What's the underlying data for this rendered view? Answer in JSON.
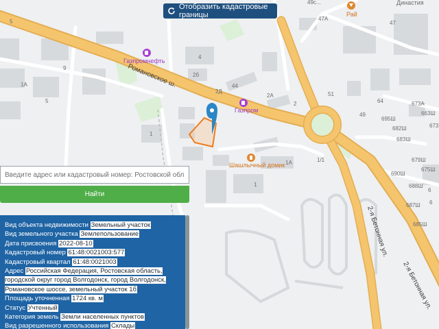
{
  "map": {
    "labels": {
      "street_romanovskoe": "Романовское ш.",
      "street_betonnaya_1": "2-я Бетонная ул.",
      "street_betonnaya_2": "2-я Бетонная ул.",
      "poi_gazpromneft": "Газпромнефть",
      "poi_gazprom": "Газпром",
      "poi_shashlychny": "Шашлычный домик",
      "poi_rai": "Рай",
      "poi_dinastia": "Династия"
    },
    "house_numbers": {
      "n5_top": "5",
      "n9": "9",
      "n1a_left": "1А",
      "n5_left": "5",
      "n1_left": "1",
      "n4": "4",
      "n2b": "2б",
      "n2d": "2Д",
      "n44": "44",
      "n2a": "2А",
      "n2_right": "2",
      "n51": "51",
      "n49": "49",
      "n47a": "47А",
      "n47": "47",
      "n49s": "49с...",
      "n1a_mid": "1А",
      "n1_1": "1/1",
      "n1_mid": "1",
      "n673a": "673А",
      "n663sh": "663Ш",
      "n695sh": "695Ш",
      "n682sh": "682Ш",
      "n673sh": "673Ш",
      "n683sh": "683Ш",
      "n679sh": "679Ш",
      "n690sh": "690Ш",
      "n675sh": "675Ш",
      "n688sh": "688Ш",
      "n687sh": "687Ш",
      "n685sh": "685Ш",
      "n64": "64",
      "n6": "6",
      "n6e": "6"
    }
  },
  "cadastral_button": {
    "label": "Отобразить кадастровые границы"
  },
  "search": {
    "placeholder": "Введите адрес или кадастровый номер: Ростовской области, Волгодонск...",
    "button_label": "Найти"
  },
  "info": {
    "rows": [
      {
        "key": "Вид объекта недвижимости",
        "value": "Земельный участок"
      },
      {
        "key": "Вид земельного участка",
        "value": "Землепользование"
      },
      {
        "key": "Дата присвоения",
        "value": "2022-08-10"
      },
      {
        "key": "Кадастровый номер",
        "value": "61:48:0021003:577"
      },
      {
        "key": "Кадастровый квартал",
        "value": "61:48:0021003"
      },
      {
        "key": "Адрес",
        "value": "Российская Федерация, Ростовская область, городской округ город Волгодонск, город Волгодонск, Романовское шоссе, земельный участок 1б"
      },
      {
        "key": "Площадь уточненная",
        "value": "1724 кв. м"
      },
      {
        "key": "Статус",
        "value": "Учтенный"
      },
      {
        "key": "Категория земель",
        "value": "Земли населенных пунктов"
      },
      {
        "key": "Вид разрешенного использования",
        "value": "Склады"
      }
    ]
  },
  "colors": {
    "main_road": "#f5c56e",
    "main_road_edge": "#e4ad51",
    "building": "#d7dadd",
    "accent_blue": "#1e4f7e",
    "parcel_outline": "#f07b1a",
    "marker": "#2b86c5",
    "find_green": "#4fae48",
    "panel_blue": "#1f64a4"
  }
}
